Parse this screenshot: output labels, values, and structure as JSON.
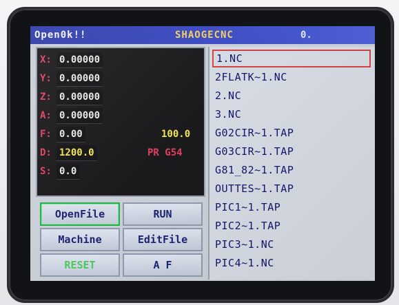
{
  "titlebar": {
    "left_text": "Open0k!!",
    "center_text": "SHAOGECNC",
    "right_text": "0."
  },
  "coordinates": [
    {
      "axis": "X:",
      "value": "0.00000"
    },
    {
      "axis": "Y:",
      "value": "0.00000"
    },
    {
      "axis": "Z:",
      "value": "0.00000"
    },
    {
      "axis": "A:",
      "value": "0.00000"
    }
  ],
  "feed": {
    "label": "F:",
    "value": "0.00",
    "override": "100.0"
  },
  "spindle": {
    "label": "D:",
    "value": "1200.0",
    "mode": "PR G54"
  },
  "speed": {
    "label": "S:",
    "value": "0.0"
  },
  "buttons": {
    "openfile": "OpenFile",
    "run": "RUN",
    "machine": "Machine",
    "editfile": "EditFile",
    "reset": "RESET",
    "af": "A  F"
  },
  "files": [
    "1.NC",
    "2FLATK~1.NC",
    "2.NC",
    "3.NC",
    "G02CIR~1.TAP",
    "G03CIR~1.TAP",
    "G81_82~1.TAP",
    "OUTTES~1.TAP",
    "PIC1~1.TAP",
    "PIC2~1.TAP",
    "PIC3~1.NC",
    "PIC4~1.NC"
  ],
  "selected_file_index": 0,
  "colors": {
    "titlebar": "#3c4cc4",
    "label_red": "#e04060",
    "value_yellow": "#f2e25a",
    "selection_red": "#d34242",
    "focus_green": "#23b04a"
  }
}
